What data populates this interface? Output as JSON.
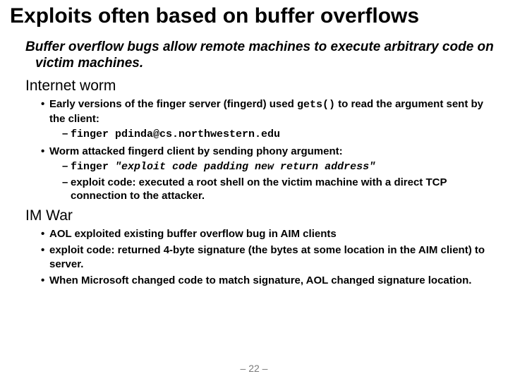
{
  "title": "Exploits often based on buffer overflows",
  "lead": "Buffer overflow bugs allow remote machines to execute arbitrary code on victim machines.",
  "section1": "Internet worm",
  "s1_b1_pre": "Early versions of the finger server (fingerd) used ",
  "s1_b1_code": "gets()",
  "s1_b1_post": " to read the argument sent by the client:",
  "s1_b1_sub1": "finger pdinda@cs.northwestern.edu",
  "s1_b2": "Worm attacked fingerd client by sending phony argument:",
  "s1_b2_sub1_cmd": "finger ",
  "s1_b2_sub1_args": "\"exploit code  padding  new return address\"",
  "s1_b2_sub2": "exploit code: executed a root shell on the victim machine with a direct TCP connection to the attacker.",
  "section2": "IM War",
  "s2_b1": "AOL exploited existing buffer overflow bug in AIM clients",
  "s2_b2": "exploit code: returned 4-byte signature (the bytes at some location in the AIM client) to server.",
  "s2_b3": "When Microsoft changed code to match signature, AOL changed signature location.",
  "pagenum": "– 22 –"
}
